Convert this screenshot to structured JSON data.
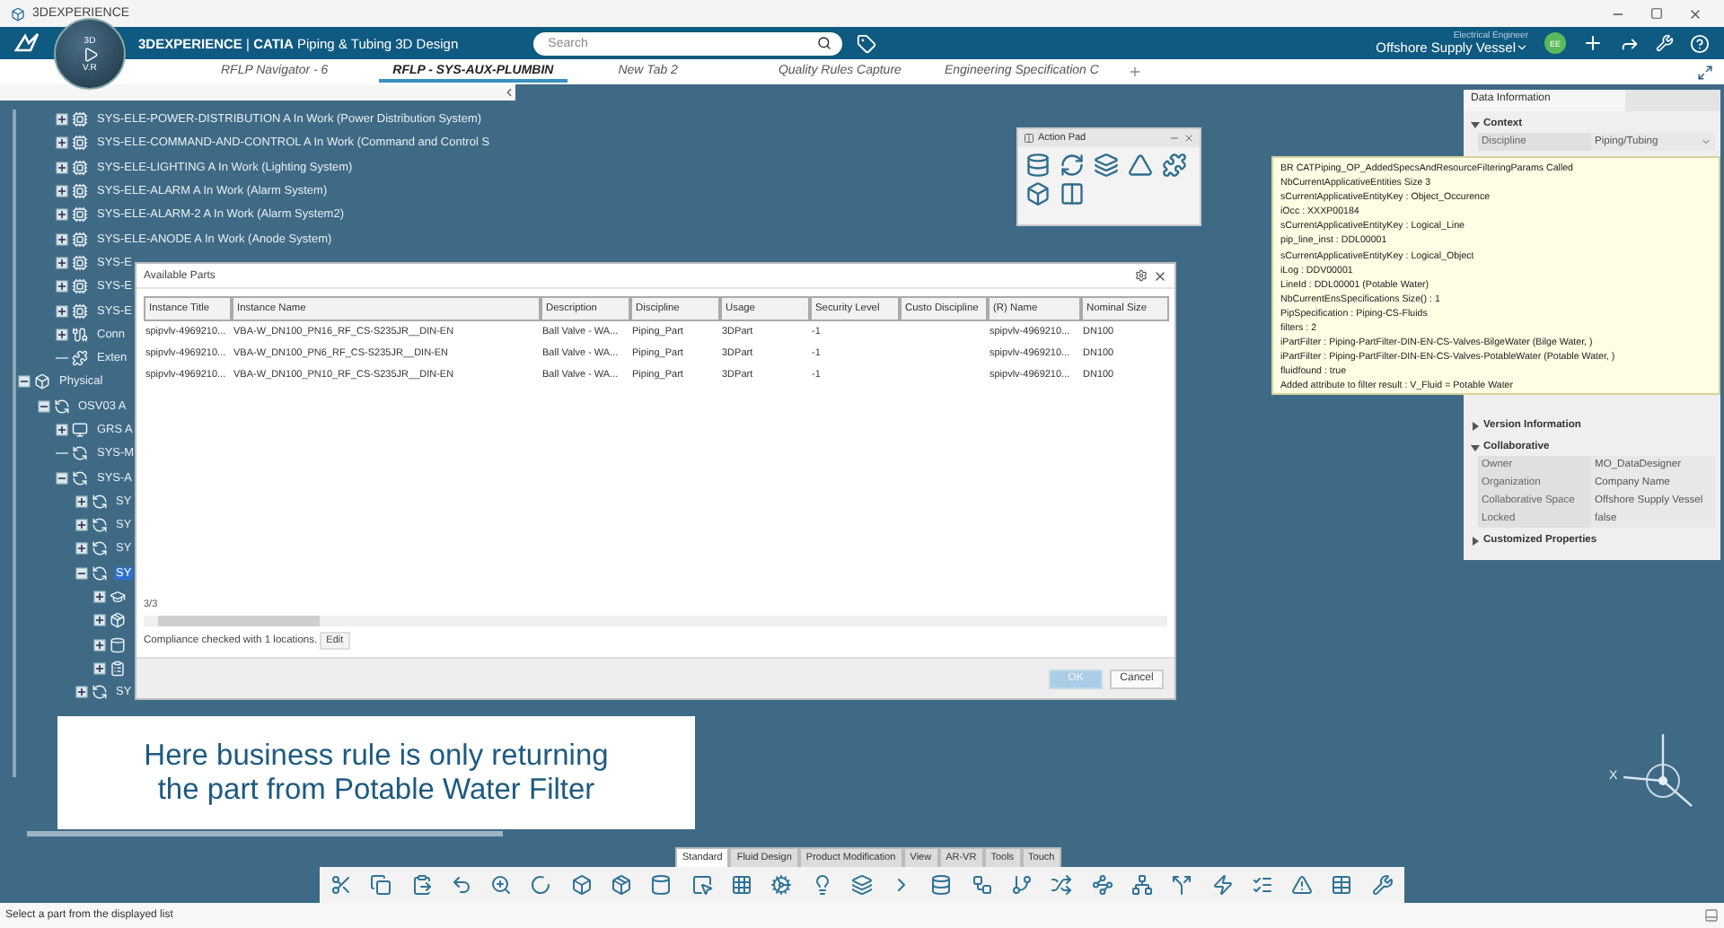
{
  "window": {
    "title": "3DEXPERIENCE"
  },
  "compass": {
    "label": "3D",
    "version": "V.R"
  },
  "app_bar": {
    "brand": "**3DEXPERIENCE** | **CATIA** Piping & Tubing 3D Design",
    "search": {
      "placeholder": "Search"
    },
    "role": "Electrical Engineer",
    "collab_space": "Offshore Supply Vessel",
    "avatar": "EE"
  },
  "tabs": [
    {
      "label": "RFLP Navigator - 6",
      "selected": false
    },
    {
      "label": "RFLP - SYS-AUX-PLUMBIN",
      "selected": true
    },
    {
      "label": "New Tab 2",
      "selected": false
    },
    {
      "label": "Quality Rules Capture",
      "selected": false
    },
    {
      "label": "Engineering Specification C",
      "selected": false
    }
  ],
  "tree": [
    {
      "children": [
        {
          "children": [
            {
              "label": "SYS-ELE-POWER-DISTRIBUTION A In Work (Power Distribution System)",
              "kind": "logical",
              "expanded": false,
              "selected": false
            },
            {
              "label": "SYS-ELE-COMMAND-AND-CONTROL A In Work (Command and Control S",
              "kind": "logical",
              "expanded": false,
              "selected": false
            },
            {
              "label": "SYS-ELE-LIGHTING A In Work (Lighting System)",
              "kind": "logical",
              "expanded": false,
              "selected": false
            },
            {
              "label": "SYS-ELE-ALARM A In Work (Alarm System)",
              "kind": "logical",
              "expanded": false,
              "selected": false
            },
            {
              "label": "SYS-ELE-ALARM-2 A In Work (Alarm System2)",
              "kind": "logical",
              "expanded": false,
              "selected": false
            },
            {
              "label": "SYS-ELE-ANODE A In Work (Anode System)",
              "kind": "logical",
              "expanded": false,
              "selected": false
            },
            {
              "label": "SYS-E",
              "kind": "logical",
              "expanded": false,
              "selected": false
            },
            {
              "label": "SYS-E",
              "kind": "logical",
              "expanded": false,
              "selected": false
            },
            {
              "label": "SYS-E",
              "kind": "logical",
              "expanded": false,
              "selected": false
            },
            {
              "label": "Conn",
              "kind": "connections",
              "expanded": false,
              "selected": false
            },
            {
              "label": "Exten",
              "kind": "extensions",
              "selected": false
            }
          ]
        }
      ]
    },
    {
      "label": "Physical",
      "kind": "physical",
      "expanded": true,
      "selected": false,
      "children": [
        {
          "label": "OSV03 A",
          "kind": "product",
          "expanded": true,
          "selected": false,
          "children": [
            {
              "label": "GRS A",
              "kind": "board",
              "expanded": false,
              "selected": false
            },
            {
              "label": "SYS-M",
              "kind": "product",
              "selected": false
            },
            {
              "label": "SYS-A",
              "kind": "product",
              "expanded": true,
              "selected": false,
              "children": [
                {
                  "label": "SY",
                  "kind": "product",
                  "expanded": false,
                  "selected": false
                },
                {
                  "label": "SY",
                  "kind": "product",
                  "expanded": false,
                  "selected": false
                },
                {
                  "label": "SY",
                  "kind": "product",
                  "expanded": false,
                  "selected": false
                },
                {
                  "label": "SY",
                  "kind": "product",
                  "expanded": true,
                  "selected": true,
                  "children": [
                    {
                      "kind": "hat",
                      "expanded": false
                    },
                    {
                      "kind": "part",
                      "expanded": false
                    },
                    {
                      "kind": "pipe",
                      "expanded": false
                    },
                    {
                      "kind": "list",
                      "expanded": false
                    }
                  ]
                },
                {
                  "label": "SY",
                  "kind": "product",
                  "expanded": false,
                  "selected": false
                }
              ]
            }
          ]
        }
      ]
    }
  ],
  "action_pad": {
    "title": "Action Pad"
  },
  "dialog": {
    "title": "Available Parts",
    "columns": [
      "Instance Title",
      "Instance Name",
      "Description",
      "Discipline",
      "Usage",
      "Security Level",
      "Custo Discipline",
      "(R) Name",
      "Nominal Size"
    ],
    "rows": [
      [
        "spipvlv-4969210...",
        "VBA-W_DN100_PN16_RF_CS-S235JR__DIN-EN",
        "Ball Valve - WA...",
        "Piping_Part",
        "3DPart",
        "-1",
        null,
        "spipvlv-4969210...",
        "DN100"
      ],
      [
        "spipvlv-4969210...",
        "VBA-W_DN100_PN6_RF_CS-S235JR__DIN-EN",
        "Ball Valve - WA...",
        "Piping_Part",
        "3DPart",
        "-1",
        null,
        "spipvlv-4969210...",
        "DN100"
      ],
      [
        "spipvlv-4969210...",
        "VBA-W_DN100_PN10_RF_CS-S235JR__DIN-EN",
        "Ball Valve - WA...",
        "Piping_Part",
        "3DPart",
        "-1",
        null,
        "spipvlv-4969210...",
        "DN100"
      ]
    ],
    "count": "3/3",
    "compliance": "Compliance checked with 1 locations.",
    "edit": "Edit",
    "buttons": [
      {
        "label": "OK",
        "disabled": true
      },
      {
        "label": "Cancel",
        "disabled": false
      }
    ]
  },
  "data_panel": {
    "title": "Data Information",
    "sections": [
      {
        "title": "Context",
        "expanded": true,
        "rows": [
          {
            "label": "Discipline",
            "value": "Piping/Tubing",
            "kind": "dropdown"
          }
        ]
      },
      {
        "title": "Version Information",
        "expanded": false
      },
      {
        "title": "Collaborative",
        "expanded": true,
        "rows": [
          {
            "label": "Owner",
            "value": "MO_DataDesigner",
            "kind": "text"
          },
          {
            "label": "Organization",
            "value": "Company Name",
            "kind": "text"
          },
          {
            "label": "Collaborative Space",
            "value": "Offshore Supply Vessel",
            "kind": "text"
          },
          {
            "label": "Locked",
            "value": "false",
            "kind": "text"
          }
        ]
      },
      {
        "title": "Customized Properties",
        "expanded": false
      }
    ]
  },
  "tooltip": {
    "lines": [
      "BR CATPiping_OP_AddedSpecsAndResourceFilteringParams Called",
      "NbCurrentApplicativeEntities Size 3",
      "sCurrentApplicativeEntityKey : Object_Occurence",
      "iOcc : XXXP00184",
      "sCurrentApplicativeEntityKey : Logical_Line",
      "pip_line_inst : DDL00001",
      "sCurrentApplicativeEntityKey : Logical_Object",
      "iLog : DDV00001",
      "LineId : DDL00001 (Potable Water)",
      "NbCurrentEnsSpecifications Size() : 1",
      "PipSpecification : Piping-CS-Fluids",
      "filters : 2",
      "iPartFilter : Piping-PartFilter-DIN-EN-CS-Valves-BilgeWater (Bilge Water, )",
      "iPartFilter : Piping-PartFilter-DIN-EN-CS-Valves-PotableWater (Potable Water, )",
      "fluidfound : true",
      "Added attribute to filter result : V_Fluid = Potable Water"
    ]
  },
  "caption": {
    "lines": [
      "Here business rule is only returning",
      "the part from Potable Water Filter"
    ]
  },
  "ribbon": {
    "tabs": [
      {
        "label": "Standard",
        "selected": true
      },
      {
        "label": "Fluid Design",
        "selected": false
      },
      {
        "label": "Product Modification",
        "selected": false
      },
      {
        "label": "View",
        "selected": false
      },
      {
        "label": "AR-VR",
        "selected": false
      },
      {
        "label": "Tools",
        "selected": false
      },
      {
        "label": "Touch",
        "selected": false
      }
    ]
  },
  "axes": {
    "label": "X"
  },
  "status_bar": {
    "message": "Select a part from the displayed list"
  }
}
